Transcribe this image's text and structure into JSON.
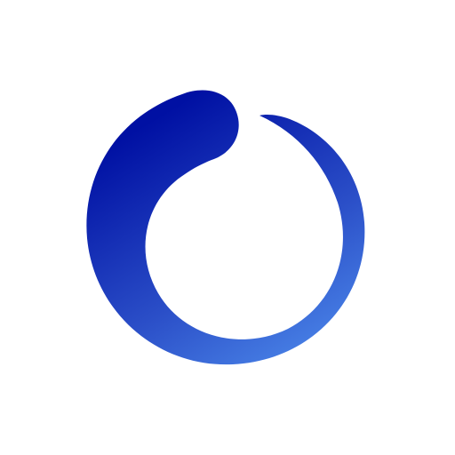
{
  "logo": {
    "name": "swirl-ring-logo",
    "icon": "circular-swirl-icon",
    "colors": {
      "background": "#ffffff",
      "gradient_start": "#0010a3",
      "gradient_mid": "#2b4fc8",
      "gradient_end": "#4f8ded"
    }
  }
}
